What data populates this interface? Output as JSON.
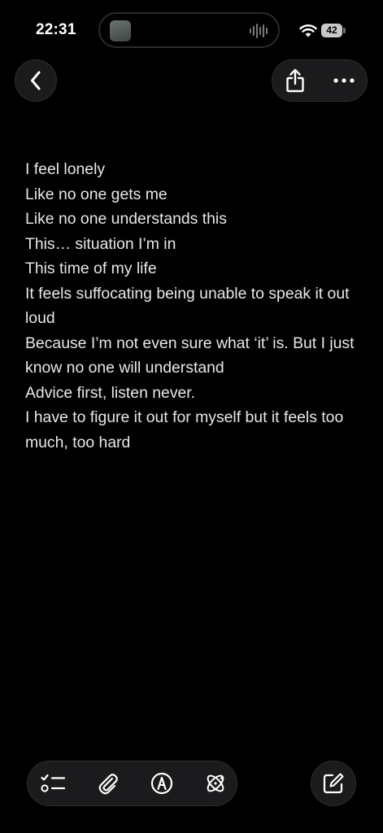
{
  "status_bar": {
    "time": "22:31",
    "battery": "42",
    "wifi_icon": "wifi-icon"
  },
  "navigation": {
    "back_icon": "chevron-left-icon",
    "share_icon": "share-icon",
    "more_icon": "ellipsis-icon"
  },
  "note": {
    "lines": [
      "I feel lonely",
      "Like no one gets me",
      "Like no one understands this",
      "This… situation I’m in",
      "This time of my life",
      "It feels suffocating being unable to speak it out loud",
      "Because I’m not even sure what ‘it’ is. But I just know no one will understand",
      "Advice first, listen never.",
      "I have to figure it out for myself but it feels too much, too hard"
    ]
  },
  "toolbar": {
    "items": [
      {
        "icon": "checklist-icon"
      },
      {
        "icon": "paperclip-icon"
      },
      {
        "icon": "markup-pen-icon"
      },
      {
        "icon": "writing-tools-icon"
      }
    ],
    "compose_icon": "compose-icon"
  },
  "colors": {
    "background": "#000000",
    "text": "#e8e8e8",
    "button_fill": "#1b1b1d",
    "icon": "#ffffff"
  }
}
